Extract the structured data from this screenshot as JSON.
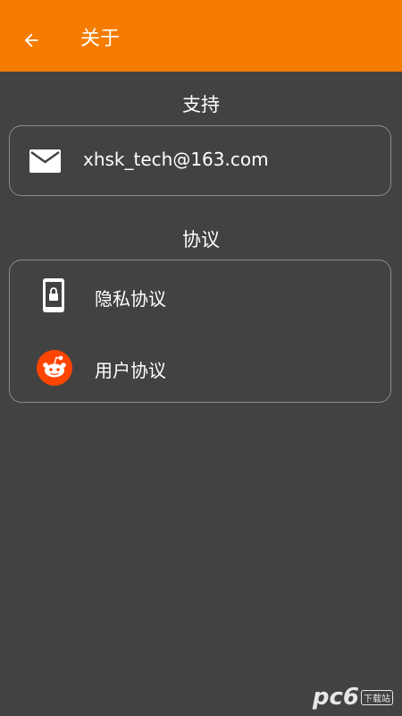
{
  "appbar": {
    "title": "关于",
    "color": "#f57c00",
    "back_icon": "arrow-left-icon"
  },
  "support": {
    "heading": "支持",
    "email_icon": "mail-icon",
    "email": "xhsk_tech@163.com"
  },
  "agreements": {
    "heading": "协议",
    "items": [
      {
        "icon": "phone-lock-icon",
        "label": "隐私协议"
      },
      {
        "icon": "reddit-icon",
        "label": "用户协议",
        "icon_color": "#ff4500"
      }
    ]
  },
  "watermark": {
    "text": "pc6",
    "tag": "下载站"
  }
}
